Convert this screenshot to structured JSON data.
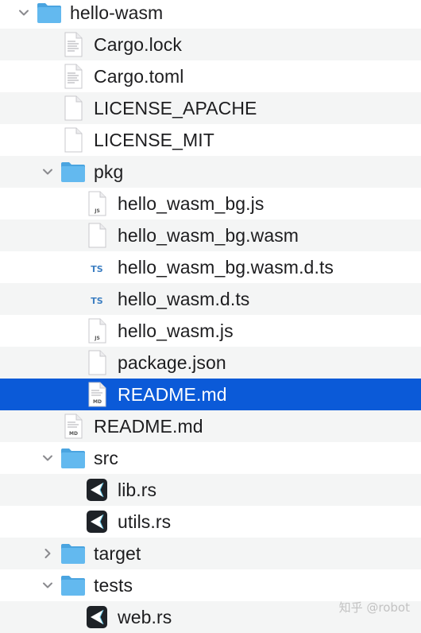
{
  "tree": {
    "items": [
      {
        "label": "hello-wasm",
        "kind": "folder",
        "expanded": true
      },
      {
        "label": "Cargo.lock",
        "kind": "text-file"
      },
      {
        "label": "Cargo.toml",
        "kind": "text-file"
      },
      {
        "label": "LICENSE_APACHE",
        "kind": "blank-file"
      },
      {
        "label": "LICENSE_MIT",
        "kind": "blank-file"
      },
      {
        "label": "pkg",
        "kind": "folder",
        "expanded": true
      },
      {
        "label": "hello_wasm_bg.js",
        "kind": "js-file",
        "badge": "JS"
      },
      {
        "label": "hello_wasm_bg.wasm",
        "kind": "blank-file"
      },
      {
        "label": "hello_wasm_bg.wasm.d.ts",
        "kind": "ts-file",
        "badge": "TS"
      },
      {
        "label": "hello_wasm.d.ts",
        "kind": "ts-file",
        "badge": "TS"
      },
      {
        "label": "hello_wasm.js",
        "kind": "js-file",
        "badge": "JS"
      },
      {
        "label": "package.json",
        "kind": "blank-file"
      },
      {
        "label": "README.md",
        "kind": "md-file",
        "badge": "MD",
        "selected": true
      },
      {
        "label": "README.md",
        "kind": "md-file",
        "badge": "MD"
      },
      {
        "label": "src",
        "kind": "folder",
        "expanded": true
      },
      {
        "label": "lib.rs",
        "kind": "rust-file"
      },
      {
        "label": "utils.rs",
        "kind": "rust-file"
      },
      {
        "label": "target",
        "kind": "folder",
        "expanded": false
      },
      {
        "label": "tests",
        "kind": "folder",
        "expanded": true
      },
      {
        "label": "web.rs",
        "kind": "rust-file"
      }
    ]
  },
  "watermark": "知乎 @robot",
  "colors": {
    "selection": "#0b5ad8",
    "stripe": "#f4f5f5",
    "folder": "#5fb6ee",
    "text": "#1d1d1f",
    "ts_badge": "#3d7fc2"
  }
}
